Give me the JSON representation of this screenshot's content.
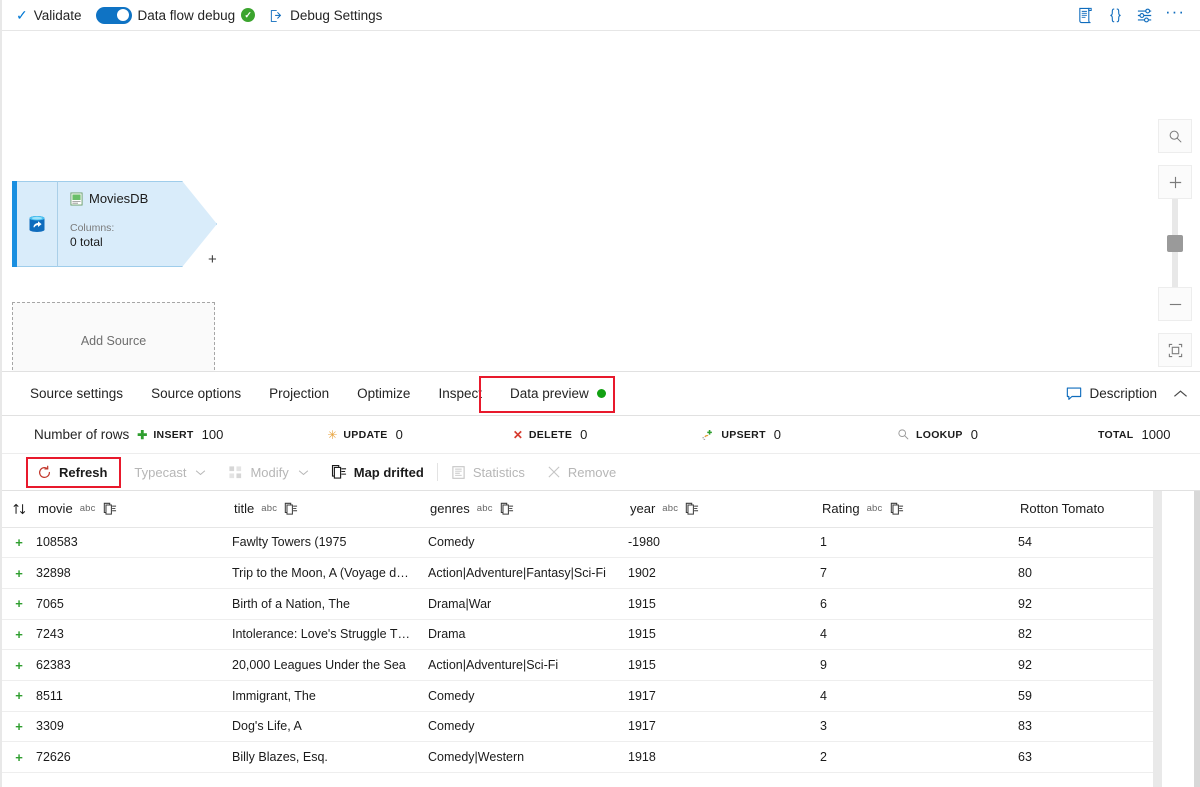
{
  "toolbar": {
    "validate_label": "Validate",
    "data_flow_debug_label": "Data flow debug",
    "debug_settings_label": "Debug Settings",
    "toggle_state": "on",
    "right_icons": [
      "script-icon",
      "code-braces-icon",
      "settings-sliders-icon",
      "more-options-icon"
    ]
  },
  "canvas": {
    "source_node": {
      "name": "MoviesDB",
      "columns_label": "Columns:",
      "columns_value": "0 total",
      "add_port_label": "+"
    },
    "add_source_label": "Add Source",
    "zoom_controls": [
      "search-icon",
      "zoom-in-icon",
      "zoom-slider",
      "zoom-out-icon",
      "fit-to-screen-icon"
    ]
  },
  "tabs": {
    "items": [
      {
        "label": "Source settings",
        "active": false
      },
      {
        "label": "Source options",
        "active": false
      },
      {
        "label": "Projection",
        "active": false
      },
      {
        "label": "Optimize",
        "active": false
      },
      {
        "label": "Inspect",
        "active": false
      },
      {
        "label": "Data preview",
        "active": true,
        "status_dot": "green"
      }
    ],
    "description_label": "Description",
    "collapse_label": "chevron-up-icon",
    "highlight_color": "#e8192c"
  },
  "stats": {
    "label": "Number of rows",
    "items": [
      {
        "name": "INSERT",
        "value": "100",
        "icon": "plus-icon",
        "color": "#2f9e2f"
      },
      {
        "name": "UPDATE",
        "value": "0",
        "icon": "asterisk-icon",
        "color": "#e8a33d"
      },
      {
        "name": "DELETE",
        "value": "0",
        "icon": "cross-icon",
        "color": "#d63a2e"
      },
      {
        "name": "UPSERT",
        "value": "0",
        "icon": "upsert-icon",
        "color": "#e8a33d"
      },
      {
        "name": "LOOKUP",
        "value": "0",
        "icon": "magnifier-icon",
        "color": "#8a8a8a"
      },
      {
        "name": "TOTAL",
        "value": "1000",
        "icon": "none",
        "color": "#1b1b1b"
      }
    ]
  },
  "actions": [
    {
      "label": "Refresh",
      "icon": "refresh-icon",
      "disabled": false,
      "highlighted": true,
      "caret": false
    },
    {
      "label": "Typecast",
      "icon": "none",
      "disabled": true,
      "highlighted": false,
      "caret": true
    },
    {
      "label": "Modify",
      "icon": "modify-icon",
      "disabled": true,
      "highlighted": false,
      "caret": true
    },
    {
      "label": "Map drifted",
      "icon": "map-drifted-icon",
      "disabled": false,
      "highlighted": false,
      "caret": false
    },
    {
      "label": "Statistics",
      "icon": "statistics-icon",
      "disabled": true,
      "highlighted": false,
      "caret": false
    },
    {
      "label": "Remove",
      "icon": "remove-icon",
      "disabled": true,
      "highlighted": false,
      "caret": false
    }
  ],
  "table": {
    "sort_icon": "sort-icon",
    "columns": [
      {
        "label": "movie",
        "type": "abc",
        "drift": true
      },
      {
        "label": "title",
        "type": "abc",
        "drift": true
      },
      {
        "label": "genres",
        "type": "abc",
        "drift": true
      },
      {
        "label": "year",
        "type": "abc",
        "drift": true
      },
      {
        "label": "Rating",
        "type": "abc",
        "drift": true
      },
      {
        "label": "Rotton Tomato",
        "type": "",
        "drift": false
      }
    ],
    "rows": [
      {
        "mark": "+",
        "movie": "108583",
        "title": "Fawlty Towers (1975",
        "genres": "Comedy",
        "year": "-1980",
        "rating": "1",
        "tomato": "54"
      },
      {
        "mark": "+",
        "movie": "32898",
        "title": "Trip to the Moon, A (Voyage d…",
        "genres": "Action|Adventure|Fantasy|Sci-Fi",
        "year": "1902",
        "rating": "7",
        "tomato": "80"
      },
      {
        "mark": "+",
        "movie": "7065",
        "title": "Birth of a Nation, The",
        "genres": "Drama|War",
        "year": "1915",
        "rating": "6",
        "tomato": "92"
      },
      {
        "mark": "+",
        "movie": "7243",
        "title": "Intolerance: Love's Struggle T…",
        "genres": "Drama",
        "year": "1915",
        "rating": "4",
        "tomato": "82"
      },
      {
        "mark": "+",
        "movie": "62383",
        "title": "20,000 Leagues Under the Sea",
        "genres": "Action|Adventure|Sci-Fi",
        "year": "1915",
        "rating": "9",
        "tomato": "92"
      },
      {
        "mark": "+",
        "movie": "8511",
        "title": "Immigrant, The",
        "genres": "Comedy",
        "year": "1917",
        "rating": "4",
        "tomato": "59"
      },
      {
        "mark": "+",
        "movie": "3309",
        "title": "Dog's Life, A",
        "genres": "Comedy",
        "year": "1917",
        "rating": "3",
        "tomato": "83"
      },
      {
        "mark": "+",
        "movie": "72626",
        "title": "Billy Blazes, Esq.",
        "genres": "Comedy|Western",
        "year": "1918",
        "rating": "2",
        "tomato": "63"
      }
    ]
  }
}
